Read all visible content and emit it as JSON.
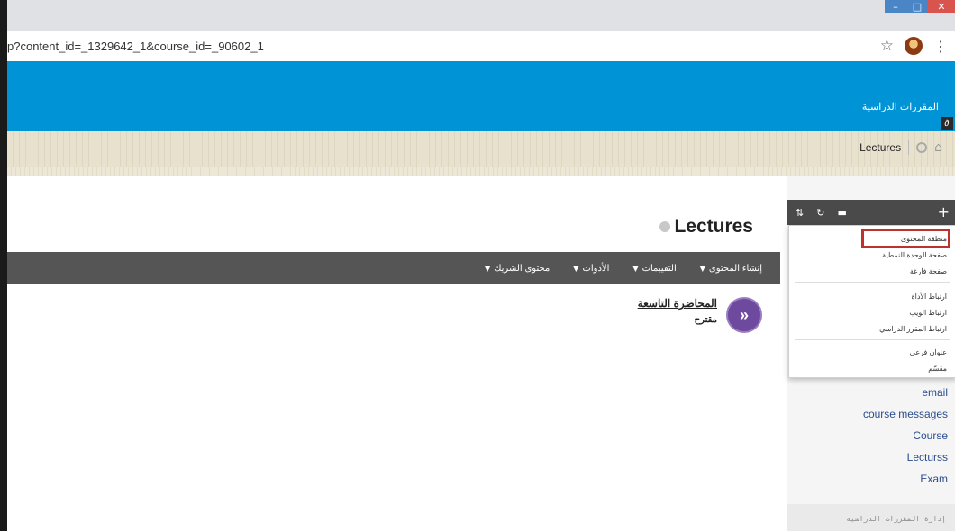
{
  "browser": {
    "url": "p?content_id=_1329642_1&course_id=_90602_1",
    "star_icon": "star-icon",
    "menu_icon": "kebab-icon",
    "window_controls": {
      "minimize": "–",
      "maximize": "□",
      "close": "✕"
    }
  },
  "header": {
    "courses_label": "المقررات الدراسية",
    "brand_color": "#0093d6"
  },
  "breadcrumb": {
    "current": "Lectures"
  },
  "page": {
    "title": "Lectures"
  },
  "action_bar": {
    "items": [
      {
        "label": "إنشاء المحتوى"
      },
      {
        "label": "التقييمات"
      },
      {
        "label": "الأدوات"
      },
      {
        "label": "محتوى الشريك"
      }
    ]
  },
  "content_item": {
    "title": "المحاضرة التاسعة",
    "subtitle": "مقترح"
  },
  "panel_toolbar": {
    "icons": [
      "sort-icon",
      "refresh-icon",
      "folder-icon",
      "plus-icon"
    ]
  },
  "dropdown": {
    "items": [
      {
        "label": "منطقة المحتوى",
        "highlighted": true
      },
      {
        "label": "صفحة الوحدة النمطية"
      },
      {
        "label": "صفحة فارغة"
      },
      {
        "label": "ارتباط الأداة"
      },
      {
        "label": "ارتباط الويب"
      },
      {
        "label": "ارتباط المقرر الدراسي"
      },
      {
        "label": "عنوان فرعي"
      },
      {
        "label": "مقسّم"
      }
    ],
    "highlight_color": "#c0312b"
  },
  "side_links": [
    {
      "label": "email"
    },
    {
      "label": "course messages"
    },
    {
      "label": "Course"
    },
    {
      "label": "Lecturss"
    },
    {
      "label": "Exam"
    }
  ],
  "panel_footer": {
    "label": "إدارة المقررات الدراسية"
  }
}
